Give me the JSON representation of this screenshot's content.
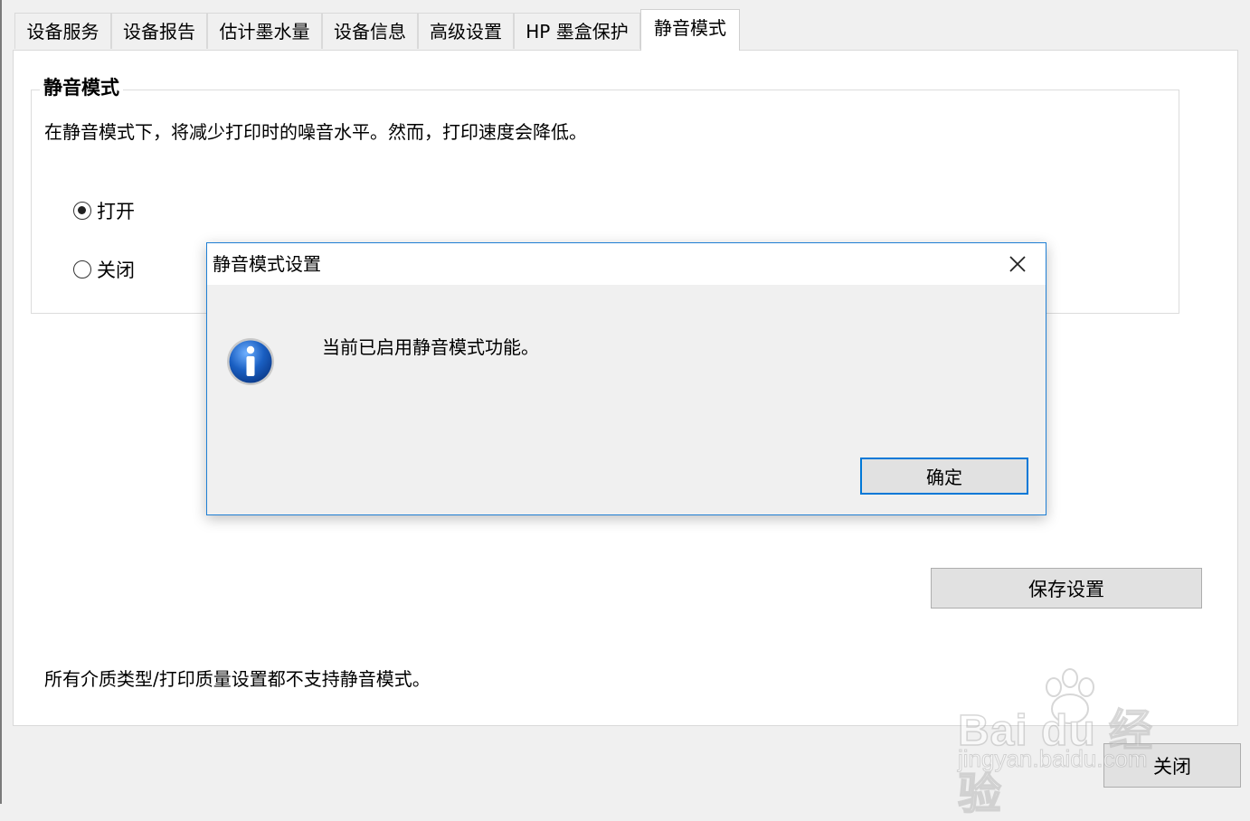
{
  "tabs": [
    {
      "label": "设备服务"
    },
    {
      "label": "设备报告"
    },
    {
      "label": "估计墨水量"
    },
    {
      "label": "设备信息"
    },
    {
      "label": "高级设置"
    },
    {
      "label": "HP 墨盒保护"
    },
    {
      "label": "静音模式",
      "active": true
    }
  ],
  "quiet_mode": {
    "group_title": "静音模式",
    "description": "在静音模式下，将减少打印时的噪音水平。然而，打印速度会降低。",
    "options": [
      {
        "label": "打开",
        "checked": true
      },
      {
        "label": "关闭",
        "checked": false
      }
    ],
    "note": "所有介质类型/打印质量设置都不支持静音模式。",
    "save_button": "保存设置"
  },
  "footer": {
    "close_button": "关闭"
  },
  "dialog": {
    "title": "静音模式设置",
    "message": "当前已启用静音模式功能。",
    "ok_button": "确定",
    "icon": "info-icon",
    "close_icon": "close-icon"
  },
  "watermark": {
    "brand": "Bai du 经验",
    "url": "jingyan.baidu.com"
  },
  "colors": {
    "dialog_border": "#1f7fd4",
    "ok_button_border": "#0078d7",
    "info_icon_blue": "#1a5fc2"
  }
}
